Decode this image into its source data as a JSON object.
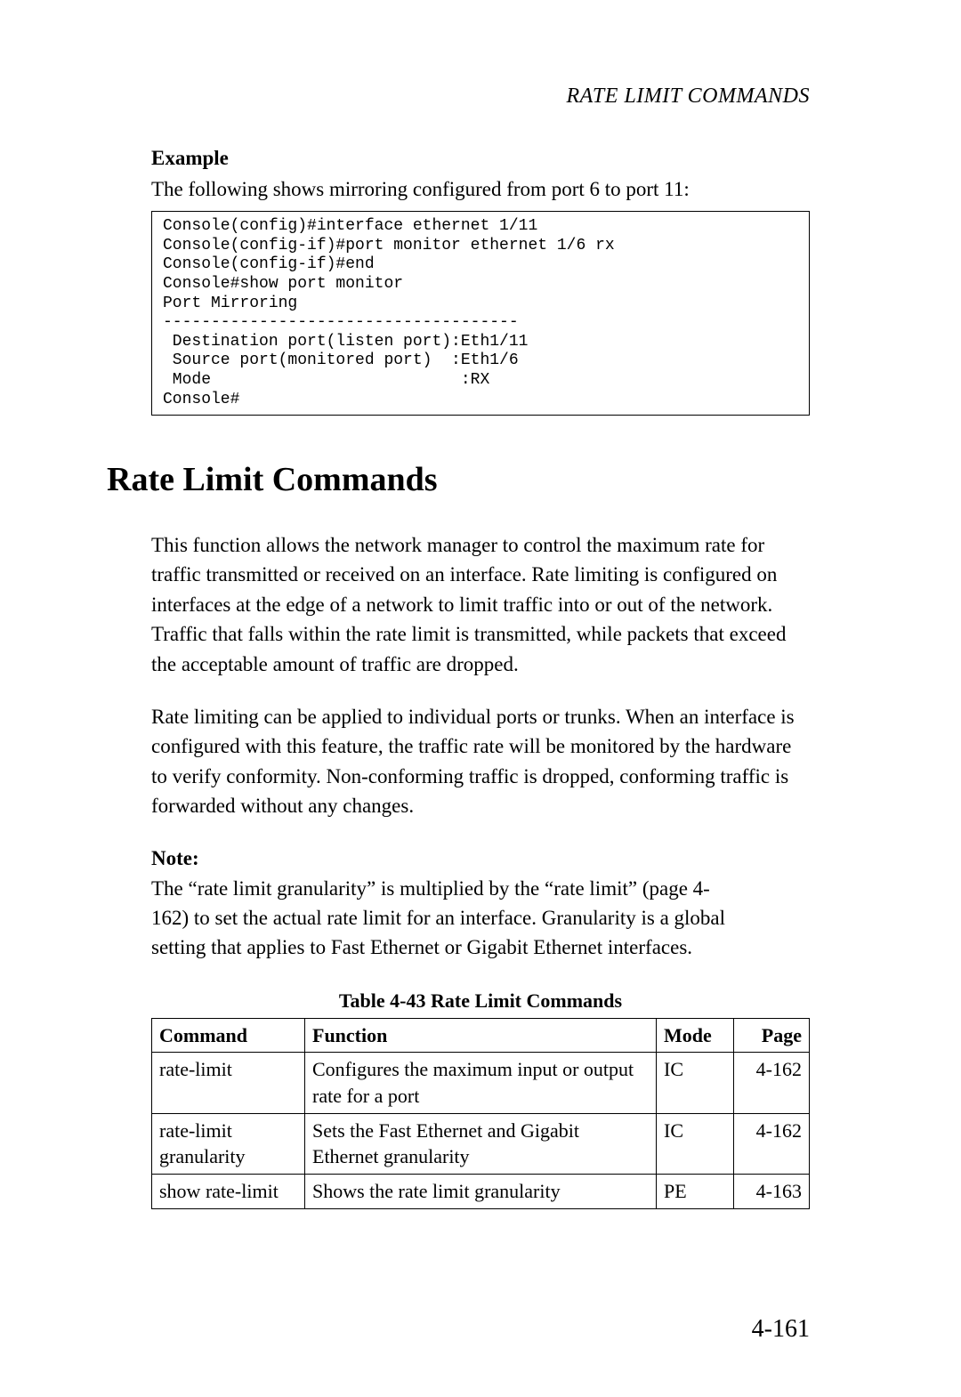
{
  "running_header": "RATE LIMIT COMMANDS",
  "example": {
    "heading": "Example",
    "intro": "The following shows mirroring configured from port 6 to port 11:",
    "code": "Console(config)#interface ethernet 1/11\nConsole(config-if)#port monitor ethernet 1/6 rx\nConsole(config-if)#end\nConsole#show port monitor\nPort Mirroring\n-------------------------------------\n Destination port(listen port):Eth1/11\n Source port(monitored port)  :Eth1/6\n Mode                          :RX\nConsole#"
  },
  "section_heading": "Rate Limit Commands",
  "paragraphs": {
    "p1": "This function allows the network manager to control the maximum rate for traffic transmitted or received on an interface. Rate limiting is configured on interfaces at the edge of a network to limit traffic into or out of the network. Traffic that falls within the rate limit is transmitted, while packets that exceed the acceptable amount of traffic are dropped.",
    "p2": "Rate limiting can be applied to individual ports or trunks. When an interface is configured with this feature, the traffic rate will be monitored by the hardware to verify conformity. Non-conforming traffic is dropped, conforming traffic is forwarded without any changes."
  },
  "note": {
    "label": "Note:",
    "text": "The “rate limit granularity” is multiplied by the “rate limit” (page 4-162) to set the actual rate limit for an interface. Granularity is a global setting that applies to Fast Ethernet or Gigabit Ethernet interfaces."
  },
  "table": {
    "caption": "Table 4-43 Rate Limit Commands",
    "headers": {
      "command": "Command",
      "function": "Function",
      "mode": "Mode",
      "page": "Page"
    },
    "rows": [
      {
        "command": "rate-limit",
        "function": "Configures the maximum input or output rate for a port",
        "mode": "IC",
        "page": "4-162"
      },
      {
        "command": "rate-limit granularity",
        "function": "Sets the Fast Ethernet and Gigabit Ethernet granularity",
        "mode": "IC",
        "page": "4-162"
      },
      {
        "command": "show rate-limit",
        "function": "Shows the rate limit granularity",
        "mode": "PE",
        "page": "4-163"
      }
    ]
  },
  "page_number": "4-161"
}
